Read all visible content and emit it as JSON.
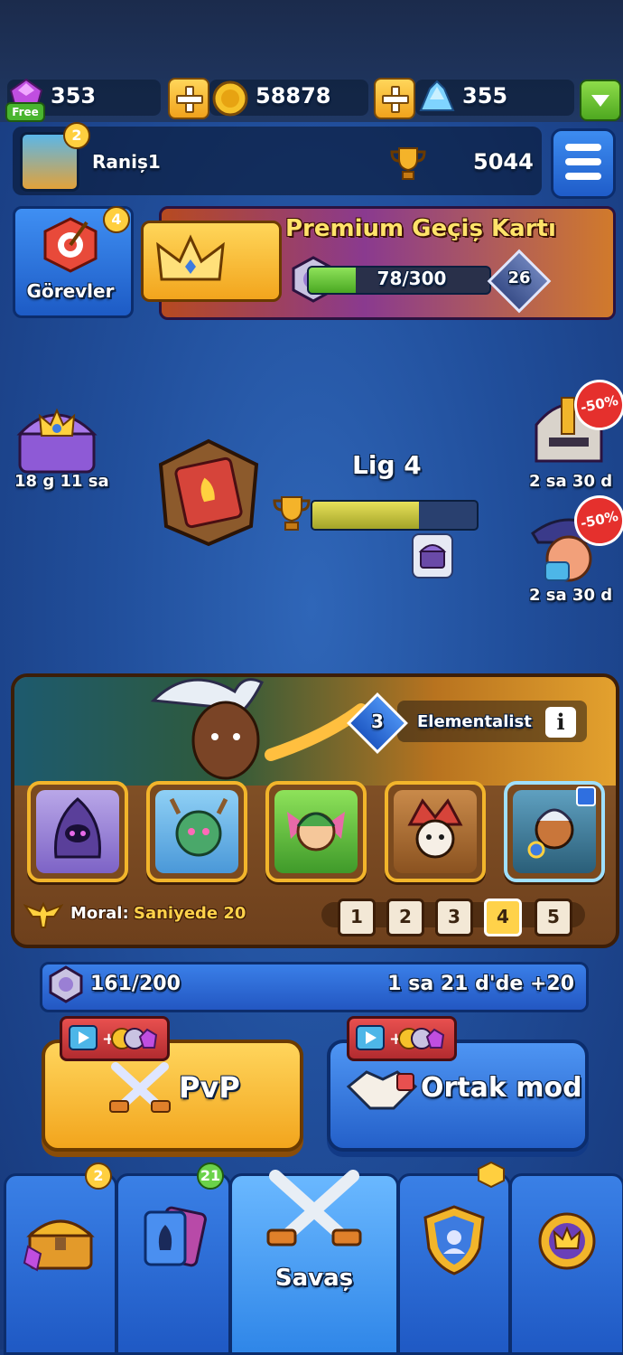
{
  "resources": {
    "gems": "353",
    "gems_tag": "Free",
    "coins": "58878",
    "crystals": "355"
  },
  "profile": {
    "level": "2",
    "name": "Raniș1",
    "trophies": "5044"
  },
  "missions": {
    "label": "Görevler",
    "badge": "4"
  },
  "pass": {
    "title": "Premium Geçiș Kartı",
    "progress_text": "78/300",
    "progress_value": 0.26,
    "level": "26"
  },
  "side": {
    "chest_timer": "18 g 11 sa",
    "offer1_discount": "-50%",
    "offer1_timer": "2 sa 30 d",
    "offer2_discount": "-50%",
    "offer2_timer": "2 sa 30 d"
  },
  "league": {
    "title": "Lig 4",
    "progress_value": 0.65
  },
  "deck": {
    "talent_level": "3",
    "talent_name": "Elementalist",
    "morale_label": "Moral:",
    "morale_value": "Saniyede 20",
    "tabs": [
      "1",
      "2",
      "3",
      "4",
      "5"
    ],
    "active_tab": "4"
  },
  "energy": {
    "value": "161/200",
    "refill": "1 sa 21 d'de +20"
  },
  "modes": {
    "pvp": "PvP",
    "coop": "Ortak mod"
  },
  "nav": {
    "shop_badge": "2",
    "cards_badge": "21",
    "battle_label": "Savaș"
  },
  "colors": {
    "accent_yellow": "#f2a51d",
    "accent_blue": "#2460c9",
    "sale_red": "#e5302d"
  }
}
